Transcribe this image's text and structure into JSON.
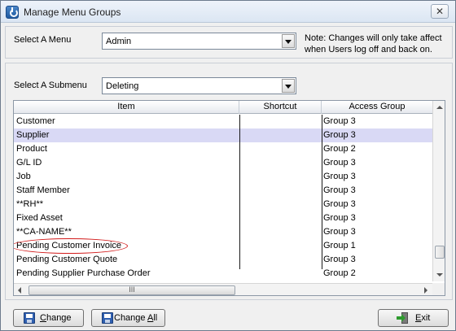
{
  "window": {
    "title": "Manage Menu Groups",
    "close_glyph": "✕"
  },
  "menu_select": {
    "label": "Select A Menu",
    "value": "Admin"
  },
  "note": {
    "text": "Note: Changes will only take affect when Users log off and back on."
  },
  "submenu_select": {
    "label": "Select A Submenu",
    "value": "Deleting"
  },
  "table": {
    "columns": [
      "Item",
      "Shortcut",
      "Access Group"
    ],
    "rows": [
      {
        "item": "Customer",
        "shortcut": "",
        "group": "Group 3"
      },
      {
        "item": "Supplier",
        "shortcut": "",
        "group": "Group 3"
      },
      {
        "item": "Product",
        "shortcut": "",
        "group": "Group 2"
      },
      {
        "item": "G/L ID",
        "shortcut": "",
        "group": "Group 3"
      },
      {
        "item": "Job",
        "shortcut": "",
        "group": "Group 3"
      },
      {
        "item": "Staff Member",
        "shortcut": "",
        "group": "Group 3"
      },
      {
        "item": "**RH**",
        "shortcut": "",
        "group": "Group 3"
      },
      {
        "item": "Fixed Asset",
        "shortcut": "",
        "group": "Group 3"
      },
      {
        "item": "**CA-NAME**",
        "shortcut": "",
        "group": "Group 3"
      },
      {
        "item": "Pending Customer Invoice",
        "shortcut": "",
        "group": "Group 1"
      },
      {
        "item": "Pending Customer Quote",
        "shortcut": "",
        "group": "Group 3"
      },
      {
        "item": "Pending Supplier Purchase Order",
        "shortcut": "",
        "group": "Group 2"
      }
    ],
    "selected_row": 1,
    "highlighted_row": 9,
    "hscroll_grip": "III"
  },
  "buttons": {
    "change": {
      "pre": "",
      "accel": "C",
      "post": "hange"
    },
    "change_all": {
      "pre": "Change ",
      "accel": "A",
      "post": "ll"
    },
    "exit": {
      "pre": "",
      "accel": "E",
      "post": "xit"
    }
  },
  "colors": {
    "selected_row": "#d9d9f5",
    "highlight_ellipse": "#d21a1a"
  }
}
